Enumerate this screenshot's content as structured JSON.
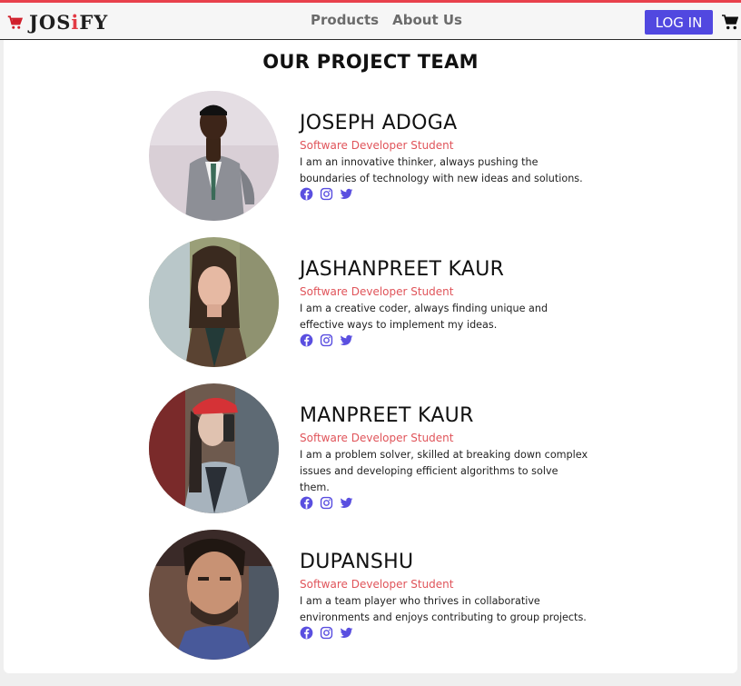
{
  "header": {
    "brand": {
      "prefix": "JOS",
      "accent": "i",
      "suffix": "FY"
    },
    "nav": [
      "Products",
      "About Us"
    ],
    "login_label": "LOG IN"
  },
  "page": {
    "title": "OUR PROJECT TEAM"
  },
  "team": [
    {
      "name": "JOSEPH ADOGA",
      "role": "Software Developer Student",
      "bio": "I am an innovative thinker, always pushing the boundaries of technology with new ideas and solutions."
    },
    {
      "name": "JASHANPREET KAUR",
      "role": "Software Developer Student",
      "bio": "I am a creative coder, always finding unique and effective ways to implement my ideas."
    },
    {
      "name": "MANPREET KAUR",
      "role": "Software Developer Student",
      "bio": "I am a problem solver, skilled at breaking down complex issues and developing efficient algorithms to solve them."
    },
    {
      "name": "DUPANSHU",
      "role": "Software Developer Student",
      "bio": "I am a team player who thrives in collaborative environments and enjoys contributing to group projects."
    }
  ],
  "social_icons": [
    "facebook-icon",
    "instagram-icon",
    "twitter-icon"
  ],
  "colors": {
    "accent_red": "#e23a44",
    "button_blue": "#5148e0",
    "role_text": "#e0545a",
    "social_blue": "#5a4fe0"
  }
}
